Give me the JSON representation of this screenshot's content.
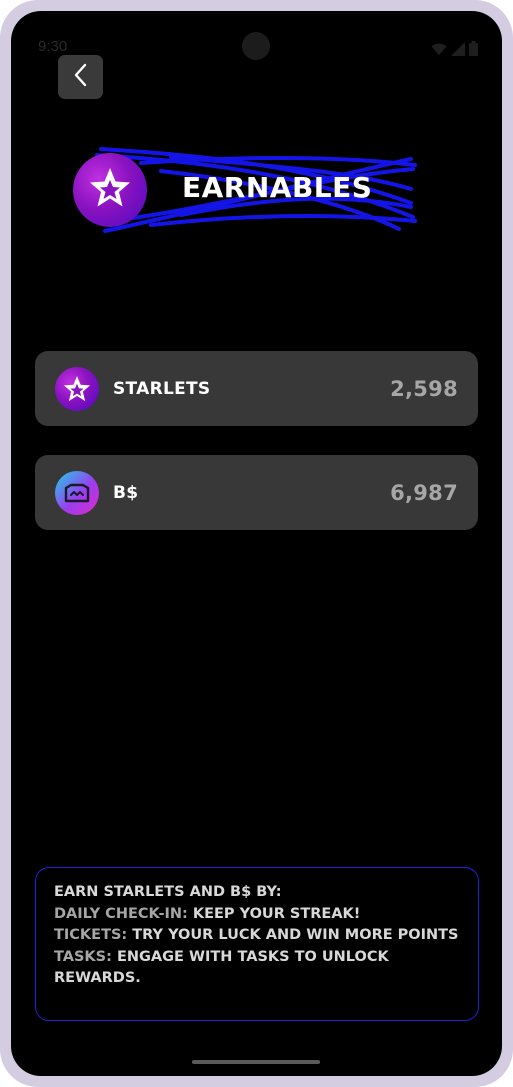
{
  "status_bar": {
    "time": "9:30"
  },
  "header": {
    "back_icon": "chevron-left-icon",
    "title": "EARNABLES",
    "logo_icon": "star-badge-icon",
    "scribble_color": "#1414e6"
  },
  "balances": [
    {
      "label": "STARLETS",
      "value": "2,598",
      "icon": "starlets-icon"
    },
    {
      "label": "B$",
      "value": "6,987",
      "icon": "bs-coin-icon"
    }
  ],
  "info": {
    "heading": "EARN STARLETS AND B$ BY:",
    "items": [
      {
        "key": "DAILY CHECK-IN:",
        "value": "KEEP YOUR STREAK!"
      },
      {
        "key": "TICKETS:",
        "value": "TRY YOUR LUCK AND WIN MORE POINTS"
      },
      {
        "key": "TASKS:",
        "value": "ENGAGE WITH TASKS TO UNLOCK REWARDS."
      }
    ],
    "border_color": "#2b1fd6"
  },
  "colors": {
    "background": "#000000",
    "card": "#383838",
    "accent_purple": "#8a12c0",
    "muted_value": "#a6a6a6"
  }
}
